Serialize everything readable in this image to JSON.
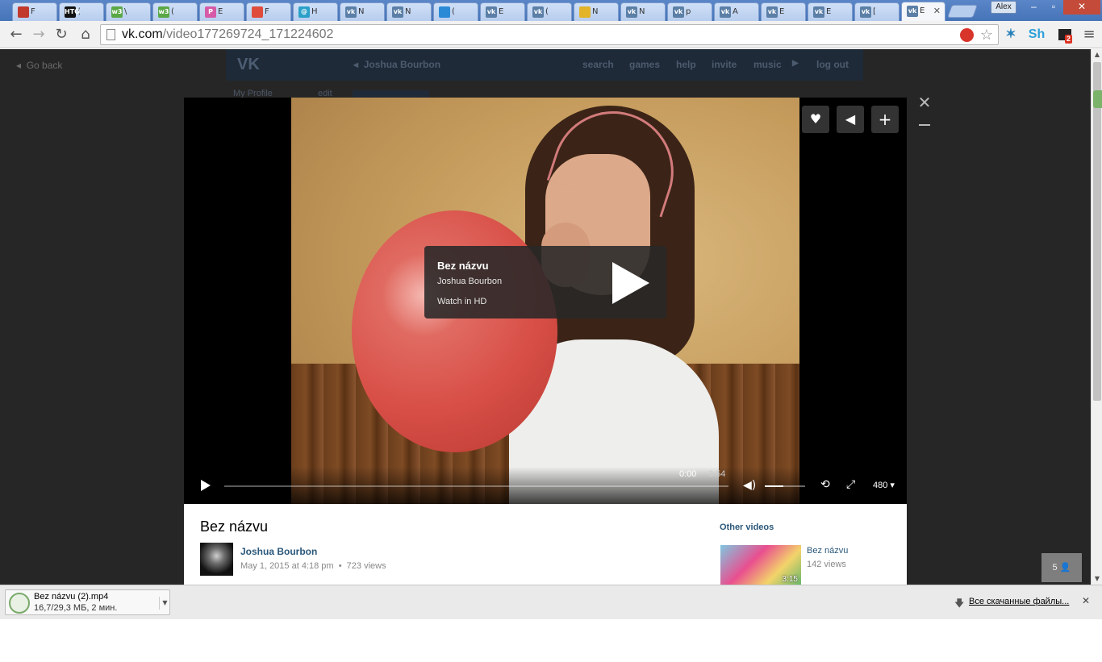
{
  "browser": {
    "tabs": [
      {
        "label": "F",
        "icon": "book-icon",
        "color": "#c0392b"
      },
      {
        "label": "(",
        "icon": "htg-icon",
        "color": "#111111",
        "icon_text": "HTG"
      },
      {
        "label": "\\",
        "icon": "w3-icon",
        "color": "#5aa845",
        "icon_text": "w3"
      },
      {
        "label": "(",
        "icon": "w3-icon",
        "color": "#5aa845",
        "icon_text": "w3"
      },
      {
        "label": "E",
        "icon": "p-icon",
        "color": "#d65aa8",
        "icon_text": "P"
      },
      {
        "label": "F",
        "icon": "windows-icon",
        "color": "#e04c3b"
      },
      {
        "label": "H",
        "icon": "at-icon",
        "color": "#2aa0c8",
        "icon_text": "@"
      },
      {
        "label": "N",
        "icon": "vk-icon",
        "color": "#5b7fa6",
        "icon_text": "vk"
      },
      {
        "label": "N",
        "icon": "vk-icon",
        "color": "#5b7fa6",
        "icon_text": "vk"
      },
      {
        "label": "(",
        "icon": "box-icon",
        "color": "#2b8ad6"
      },
      {
        "label": "E",
        "icon": "vk-icon",
        "color": "#5b7fa6",
        "icon_text": "vk"
      },
      {
        "label": "(",
        "icon": "vk-icon",
        "color": "#5b7fa6",
        "icon_text": "vk"
      },
      {
        "label": "N",
        "icon": "cloud-icon",
        "color": "#e3b42a"
      },
      {
        "label": "N",
        "icon": "vk-icon",
        "color": "#5b7fa6",
        "icon_text": "vk"
      },
      {
        "label": "p",
        "icon": "vk-icon",
        "color": "#5b7fa6",
        "icon_text": "vk"
      },
      {
        "label": "A",
        "icon": "vk-icon",
        "color": "#5b7fa6",
        "icon_text": "vk"
      },
      {
        "label": "E",
        "icon": "vk-icon",
        "color": "#5b7fa6",
        "icon_text": "vk"
      },
      {
        "label": "E",
        "icon": "vk-icon",
        "color": "#5b7fa6",
        "icon_text": "vk"
      },
      {
        "label": "[",
        "icon": "vk-icon",
        "color": "#5b7fa6",
        "icon_text": "vk"
      },
      {
        "label": "E",
        "icon": "vk-icon",
        "color": "#5b7fa6",
        "icon_text": "vk",
        "active": true
      }
    ],
    "user_name": "Alex",
    "url_host": "vk.com",
    "url_path": "/video177269724_171224602",
    "ext_badge": "2",
    "ext_sh": "Sh"
  },
  "vk": {
    "go_back": "Go back",
    "header_user": "Joshua Bourbon",
    "nav": [
      "search",
      "games",
      "help",
      "invite",
      "music"
    ],
    "logout": "log out",
    "my_profile": "My Profile",
    "edit": "edit"
  },
  "player": {
    "overlay_title": "Bez názvu",
    "overlay_author": "Joshua Bourbon",
    "overlay_hd": "Watch in HD",
    "time_current": "0:00",
    "time_duration": "3:54",
    "quality": "480",
    "volume_level": 0.45,
    "progress": 0.0
  },
  "info": {
    "title": "Bez názvu",
    "author": "Joshua Bourbon",
    "date": "May 1, 2015 at 4:18 pm",
    "views": "723 views",
    "other_videos_title": "Other videos",
    "other_videos": [
      {
        "title": "Bez názvu",
        "views": "142 views",
        "duration": "3:15"
      }
    ]
  },
  "viewer_count": "5",
  "downloads": {
    "file_name": "Bez názvu (2).mp4",
    "status": "16,7/29,3 МБ, 2 мин.",
    "all_downloads": "Все скачанные файлы..."
  }
}
